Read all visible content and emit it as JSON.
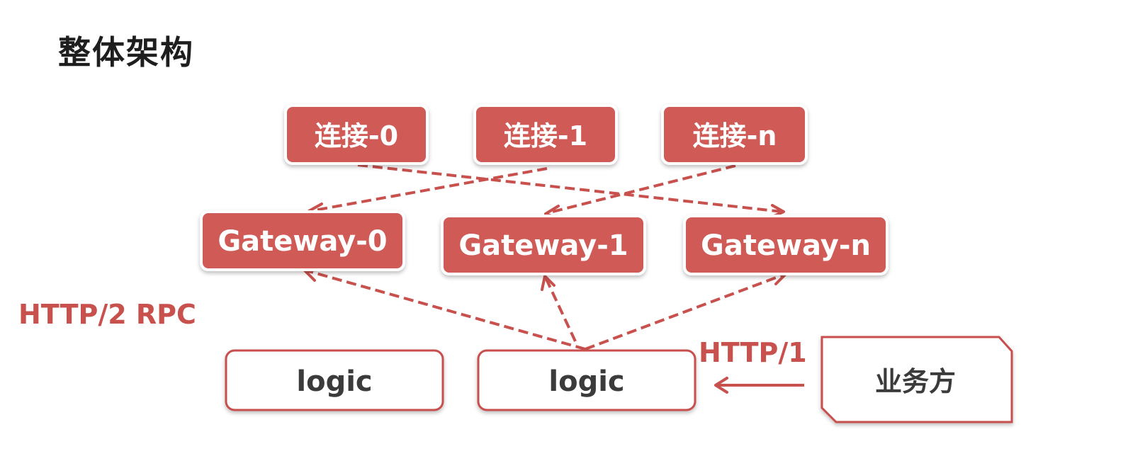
{
  "title": "整体架构",
  "labels": {
    "rpc": "HTTP/2 RPC",
    "http1": "HTTP/1"
  },
  "nodes": {
    "conn0": "连接-0",
    "conn1": "连接-1",
    "connN": "连接-n",
    "gw0": "Gateway-0",
    "gw1": "Gateway-1",
    "gwN": "Gateway-n",
    "logic1": "logic",
    "logic2": "logic",
    "business": "业务方"
  },
  "colors": {
    "accent": "#cf5a56",
    "text_dark": "#3a3a3a"
  }
}
